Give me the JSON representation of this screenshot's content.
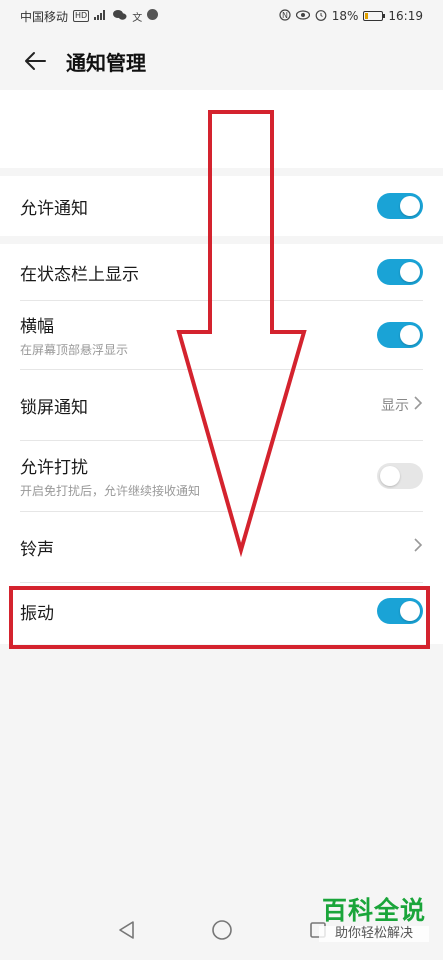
{
  "status_bar": {
    "carrier": "中国移动",
    "hd_badge": "HD",
    "signal": "4G",
    "battery": "18%",
    "battery_level": 0.18,
    "time": "16:19"
  },
  "header": {
    "title": "通知管理"
  },
  "settings": {
    "allow_notifications": {
      "label": "允许通知",
      "state": "on"
    },
    "show_in_status_bar": {
      "label": "在状态栏上显示",
      "state": "on"
    },
    "banner": {
      "label": "横幅",
      "sub": "在屏幕顶部悬浮显示",
      "state": "on"
    },
    "lock_screen": {
      "label": "锁屏通知",
      "value": "显示"
    },
    "dnd": {
      "label": "允许打扰",
      "sub": "开启免打扰后，允许继续接收通知",
      "state": "off"
    },
    "ringtone": {
      "label": "铃声"
    },
    "vibration": {
      "label": "振动",
      "state": "on"
    }
  },
  "watermark": {
    "brand": "百科全说",
    "slogan": "助你轻松解决"
  },
  "colors": {
    "accent": "#1aa3d6",
    "annotation_red": "#d4232e",
    "watermark_green": "#1aa53a"
  }
}
